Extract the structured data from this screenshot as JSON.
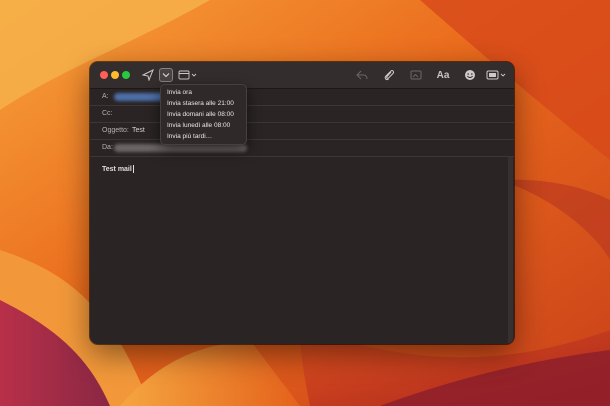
{
  "mail": {
    "labels": {
      "to": "A:",
      "cc": "Cc:",
      "subject": "Oggetto:",
      "from": "Da:"
    },
    "subject_value": "Test",
    "body_text": "Test mail",
    "font_button_label": "Aa"
  },
  "send_later_menu": {
    "items": [
      {
        "label": "Invia ora"
      },
      {
        "label": "Invia stasera alle 21:00"
      },
      {
        "label": "Invia domani alle 08:00"
      },
      {
        "label": "Invia lunedì alle 08:00"
      },
      {
        "label": "Invia più tardi…"
      }
    ]
  },
  "colors": {
    "close": "#ff5f57",
    "minimize": "#febc2e",
    "zoom": "#28c840",
    "window_bg": "#2a2424",
    "menu_bg": "#2f2929"
  },
  "icons": [
    "send-icon",
    "chevron-down-icon",
    "format-icon",
    "reply-icon",
    "paperclip-icon",
    "photo-icon",
    "emoji-icon",
    "media-browser-icon"
  ]
}
